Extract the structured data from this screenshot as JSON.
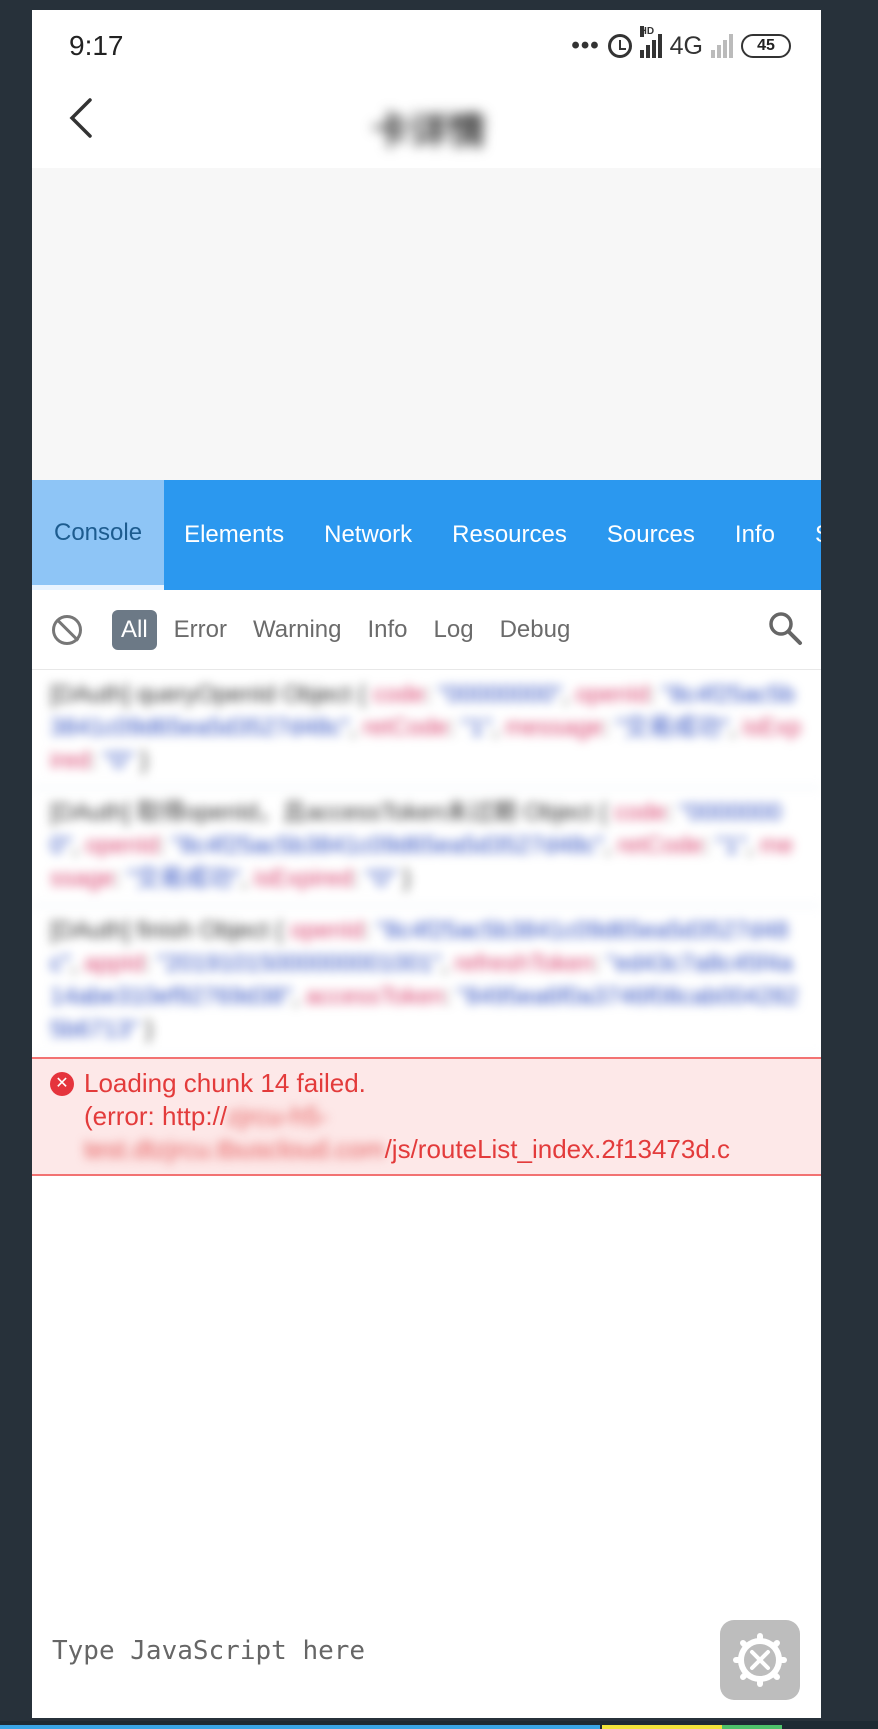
{
  "status_bar": {
    "time": "9:17",
    "dots": "•••",
    "hd_label": "HD",
    "network": "4G",
    "battery": "45"
  },
  "header": {
    "title": "卡详情"
  },
  "devtools": {
    "tabs": [
      {
        "label": "Console",
        "active": true
      },
      {
        "label": "Elements"
      },
      {
        "label": "Network"
      },
      {
        "label": "Resources"
      },
      {
        "label": "Sources"
      },
      {
        "label": "Info"
      },
      {
        "label": "S"
      }
    ],
    "filters": [
      "All",
      "Error",
      "Warning",
      "Info",
      "Log",
      "Debug"
    ],
    "active_filter": "All"
  },
  "logs": [
    {
      "prefix": "[DAuth] queryOpenId Object { ",
      "fields": [
        {
          "k": "code",
          "v": "\"00000000\""
        },
        {
          "k": "openId",
          "v": "\"8c4f25ac5b3841c09d65ea5d3527d48c\""
        },
        {
          "k": "retCode",
          "v": "\"1\""
        },
        {
          "k": "message",
          "v": "\"交易成功\""
        },
        {
          "k": "isExpired",
          "v": "\"0\""
        }
      ]
    },
    {
      "prefix": "[DAuth] 取得openId，且accessToken未过期 Object { ",
      "fields": [
        {
          "k": "code",
          "v": "\"00000000\""
        },
        {
          "k": "openId",
          "v": "\"8c4f25ac5b3841c09d65ea5d3527d48c\""
        },
        {
          "k": "retCode",
          "v": "\"1\""
        },
        {
          "k": "message",
          "v": "\"交易成功\""
        },
        {
          "k": "isExpired",
          "v": "\"0\""
        }
      ]
    },
    {
      "prefix": "[DAuth] finish Object { ",
      "fields": [
        {
          "k": "openId",
          "v": "\"8c4f25ac5b3841c09d65ea5d3527d48c\""
        },
        {
          "k": "appId",
          "v": "\"20191015000000001001\""
        },
        {
          "k": "refreshToken",
          "v": "\"ed43c7a8c45f4a14abe310ef92769d38\""
        },
        {
          "k": "accessToken",
          "v": "\"8495ea6f0a3746f08cab0042825b6713\""
        }
      ]
    }
  ],
  "error": {
    "line1": "Loading chunk 14 failed.",
    "prefix": "(error: http://",
    "host": "zjrcu-h5-test.dtzjrcu.tbuscloud.com",
    "path": "/js/routeList_index.2f13473d.c"
  },
  "console_input": {
    "placeholder": "Type JavaScript here"
  },
  "colors": {
    "tabbar": "#2b98ef",
    "active_tab": "#8ec5f6",
    "error_bg": "#fde8e8",
    "error_text": "#e33b3b"
  }
}
